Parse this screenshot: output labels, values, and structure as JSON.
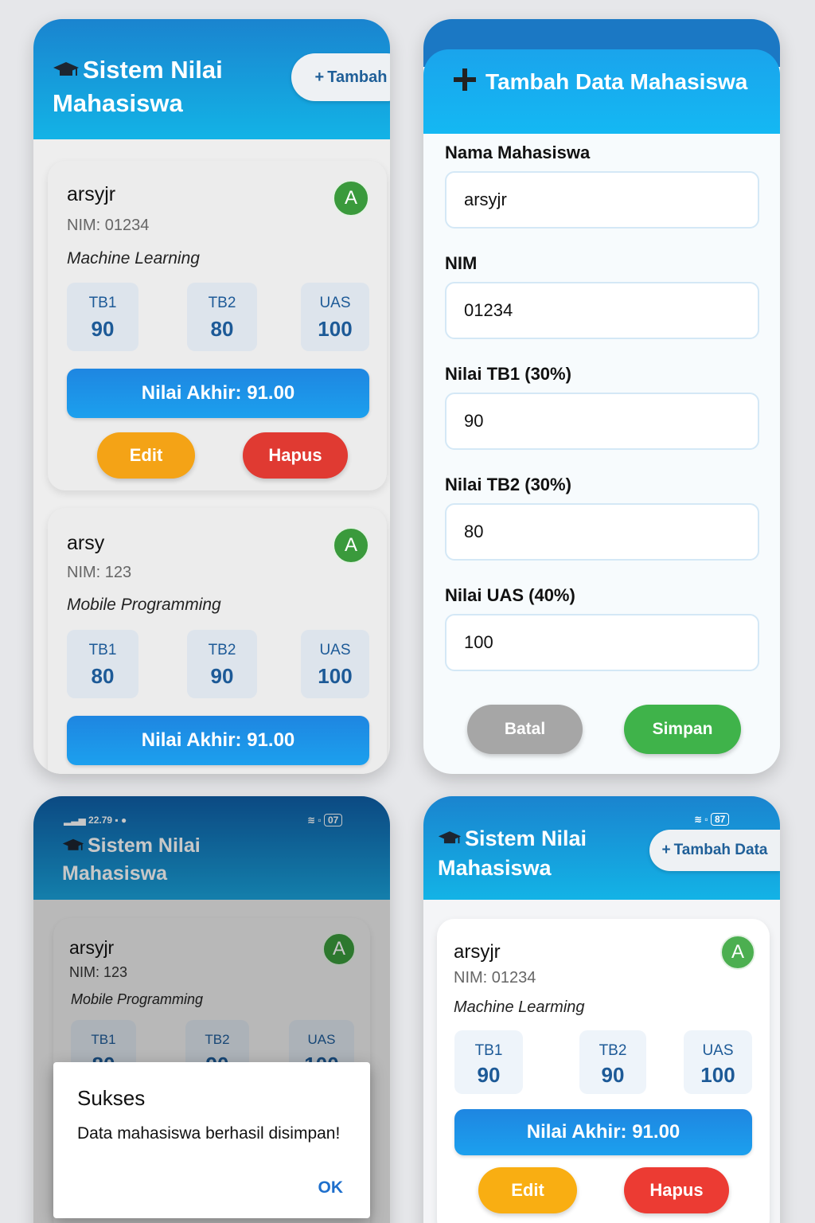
{
  "app": {
    "title_line1": "Sistem Nilai",
    "title_line2": "Mahasiswa",
    "icon": "graduation-cap-icon"
  },
  "screen1": {
    "add_label": "Tambah",
    "cards": [
      {
        "name": "arsyjr",
        "nim": "NIM: 01234",
        "course": "Machine Learning",
        "grade": "A",
        "scores": [
          {
            "label": "TB1",
            "value": "90"
          },
          {
            "label": "TB2",
            "value": "80"
          },
          {
            "label": "UAS",
            "value": "100"
          }
        ],
        "final": "Nilai Akhir: 91.00",
        "edit": "Edit",
        "delete": "Hapus"
      },
      {
        "name": "arsy",
        "nim": "NIM: 123",
        "course": "Mobile Programming",
        "grade": "A",
        "scores": [
          {
            "label": "TB1",
            "value": "80"
          },
          {
            "label": "TB2",
            "value": "90"
          },
          {
            "label": "UAS",
            "value": "100"
          }
        ],
        "final": "Nilai Akhir: 91.00"
      }
    ]
  },
  "form": {
    "title": "Tambah Data Mahasiswa",
    "fields": [
      {
        "label": "Nama Mahasiswa",
        "value": "arsyjr"
      },
      {
        "label": "NIM",
        "value": "01234"
      },
      {
        "label": "Nilai TB1 (30%)",
        "value": "90"
      },
      {
        "label": "Nilai TB2 (30%)",
        "value": "80"
      },
      {
        "label": "Nilai UAS (40%)",
        "value": "100"
      }
    ],
    "cancel": "Batal",
    "save": "Simpan"
  },
  "screen3": {
    "status_time": "22.79",
    "status_battery": "07",
    "card": {
      "name": "arsyjr",
      "nim": "NIM: 123",
      "course": "Mobile Programming",
      "grade": "A",
      "scores": [
        {
          "label": "TB1",
          "value": "80"
        },
        {
          "label": "TB2",
          "value": "90"
        },
        {
          "label": "UAS",
          "value": "100"
        }
      ]
    },
    "dialog": {
      "title": "Sukses",
      "message": "Data mahasiswa berhasil disimpan!",
      "ok": "OK"
    }
  },
  "screen4": {
    "status_battery": "87",
    "add_label": "Tambah Data",
    "card": {
      "name": "arsyjr",
      "nim": "NIM: 01234",
      "course": "Machine Learming",
      "grade": "A",
      "scores": [
        {
          "label": "TB1",
          "value": "90"
        },
        {
          "label": "TB2",
          "value": "90"
        },
        {
          "label": "UAS",
          "value": "100"
        }
      ],
      "final": "Nilai Akhir: 91.00",
      "edit": "Edit",
      "delete": "Hapus"
    }
  },
  "colors": {
    "primary": "#1a84cf",
    "accent": "#13b3e6",
    "edit": "#f4a316",
    "delete": "#e03a32",
    "save": "#3fb34a",
    "cancel": "#a6a6a6",
    "grade": "#3a9a3c"
  }
}
